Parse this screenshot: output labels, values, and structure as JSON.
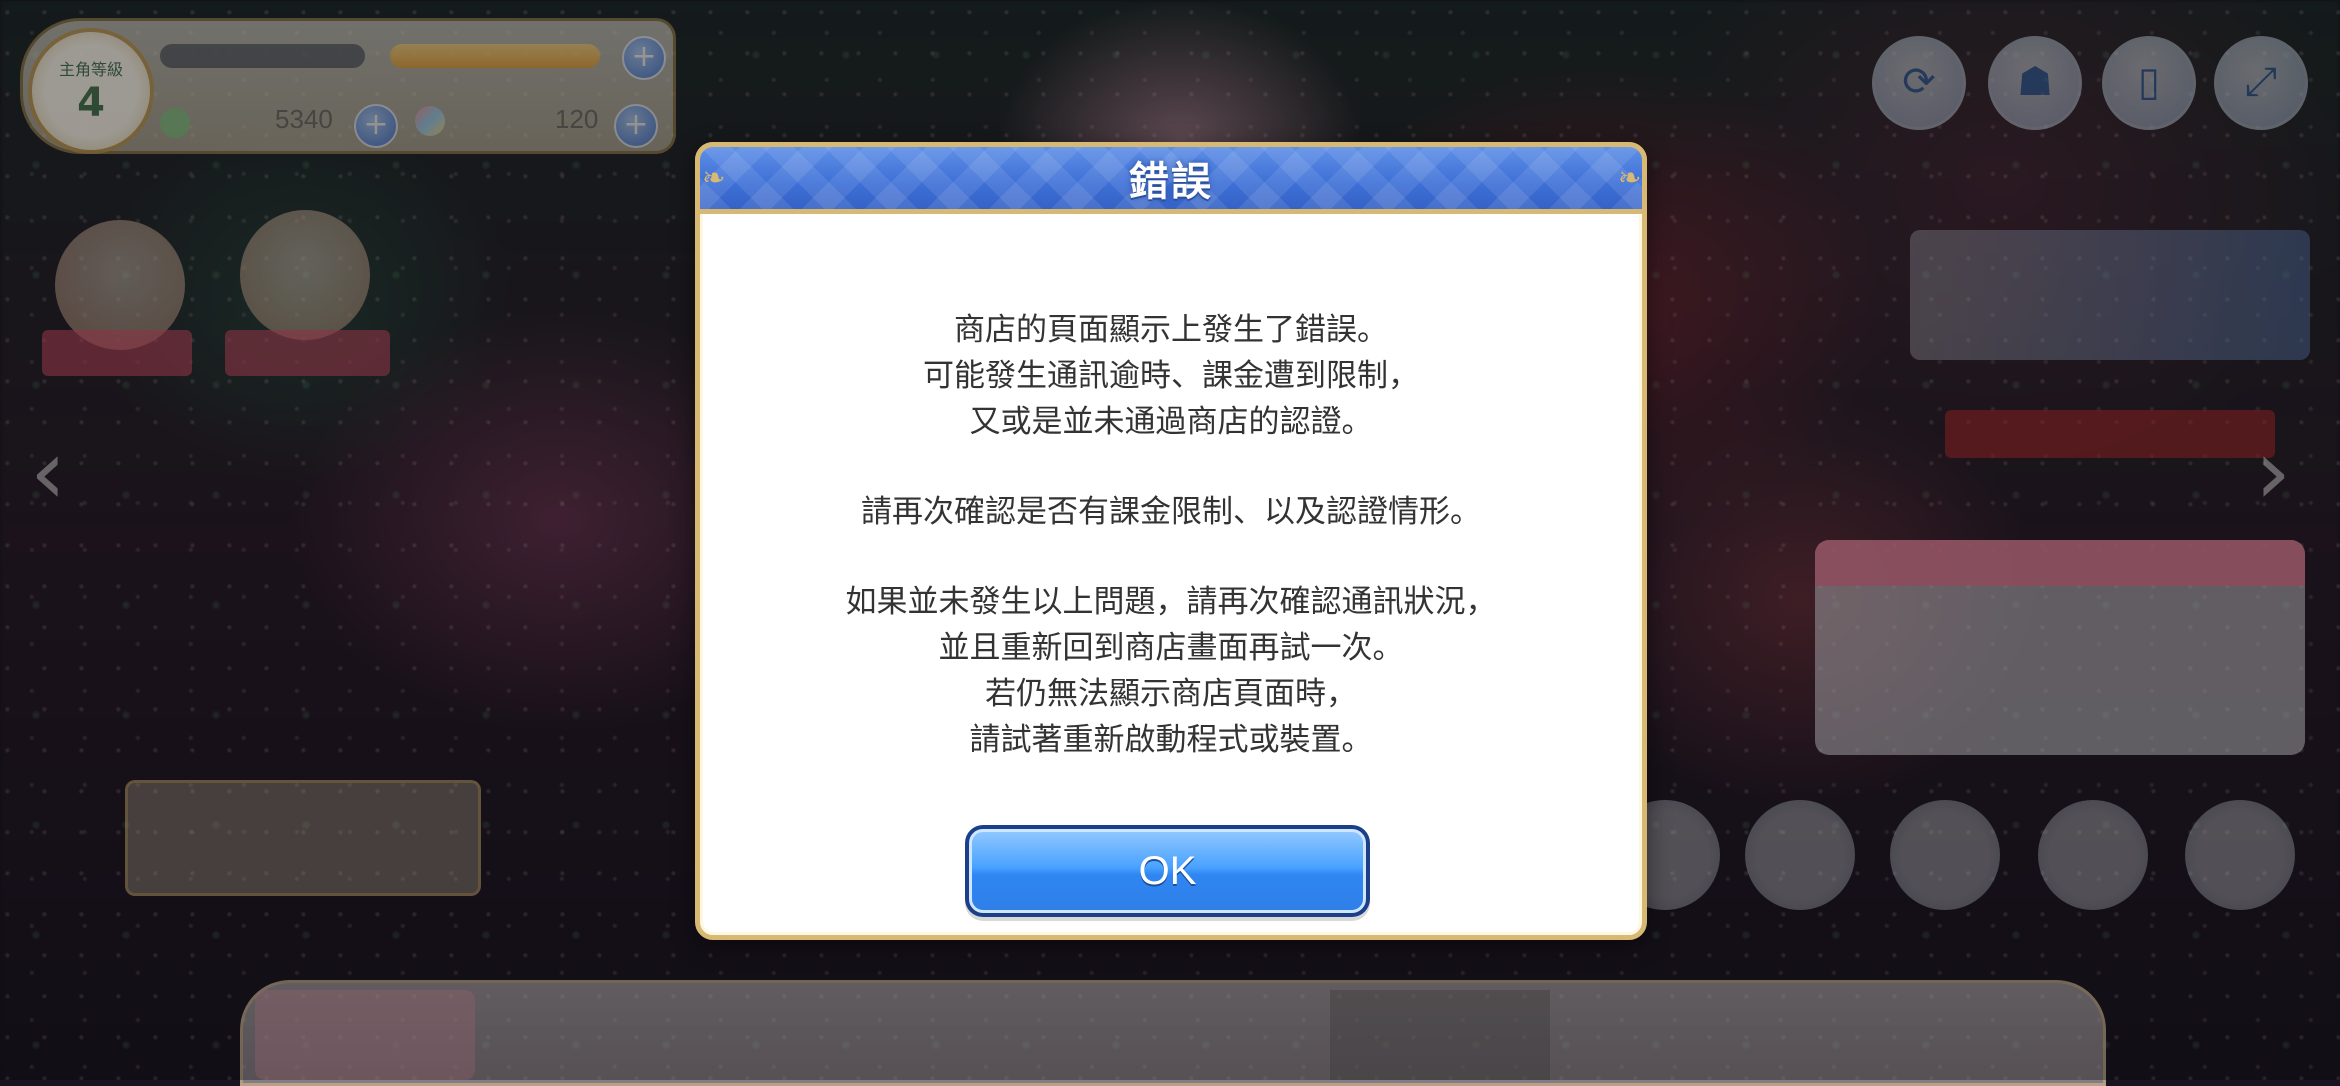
{
  "player": {
    "level_label": "主角等級",
    "level": "4",
    "jewels": "5340",
    "mana": "120"
  },
  "top_menu": {
    "buttons": [
      "refresh-icon",
      "profile-icon",
      "window-icon",
      "fullscreen-icon"
    ]
  },
  "dialog": {
    "title": "錯誤",
    "paragraphs": [
      [
        "商店的頁面顯示上發生了錯誤。",
        "可能發生通訊逾時、課金遭到限制，",
        "又或是並未通過商店的認證。"
      ],
      [
        "請再次確認是否有課金限制、以及認證情形。"
      ],
      [
        "如果並未發生以上問題，請再次確認通訊狀況，",
        "並且重新回到商店畫面再試一次。",
        "若仍無法顯示商店頁面時，",
        "請試著重新啟動程式或裝置。"
      ]
    ],
    "ok_label": "OK"
  },
  "colors": {
    "dialog_header": "#3d6fd6",
    "dialog_border": "#d7b974",
    "ok_button": "#2f86f2"
  }
}
